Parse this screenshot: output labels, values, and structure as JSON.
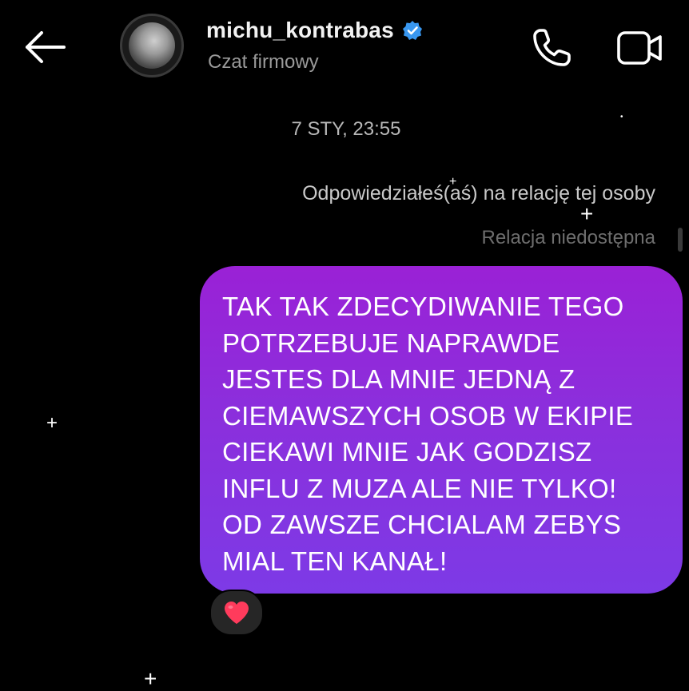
{
  "header": {
    "username": "michu_kontrabas",
    "subtitle": "Czat firmowy",
    "icons": {
      "back": "back-arrow-icon",
      "verified": "verified-badge-icon",
      "call": "phone-icon",
      "video": "video-camera-icon"
    },
    "verified_color": "#3897f0"
  },
  "conversation": {
    "timestamp": "7 STY, 23:55",
    "story_reply_note": "Odpowiedziałeś(aś) na relację tej osoby",
    "story_status": "Relacja niedostępna",
    "message": {
      "text": "TAK TAK ZDECYDIWANIE TEGO\nPOTRZEBUJE NAPRAWDE\nJESTES DLA MNIE JEDNĄ Z\nCIEMAWSZYCH OSOB W EKIPIE\nCIEKAWI MNIE JAK GODZISZ\nINFLU Z MUZA ALE NIE TYLKO!\nOD ZAWSZE CHCIALAM ZEBYS\nMIAL TEN KANAŁ!",
      "bubble_color_top": "#9a21d6",
      "bubble_color_bottom": "#7d3ae6"
    },
    "reaction": {
      "emoji": "heart-icon",
      "color": "#ff3b5c"
    }
  },
  "theme": {
    "background": "#000000",
    "text_primary": "#f2f2f2",
    "text_secondary": "#9a9a9a"
  }
}
